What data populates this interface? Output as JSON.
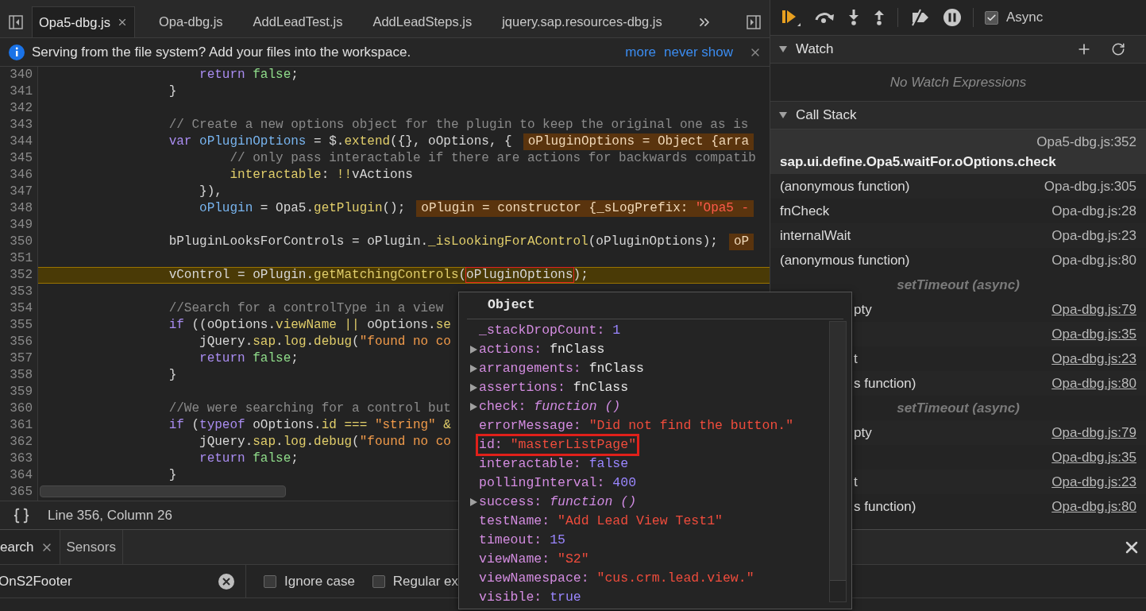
{
  "editor_tabs": [
    {
      "label": "Opa5-dbg.js",
      "selected": true,
      "closable": true
    },
    {
      "label": "Opa-dbg.js",
      "selected": false,
      "closable": false
    },
    {
      "label": "AddLeadTest.js",
      "selected": false,
      "closable": false
    },
    {
      "label": "AddLeadSteps.js",
      "selected": false,
      "closable": false
    },
    {
      "label": "jquery.sap.resources-dbg.js",
      "selected": false,
      "closable": false
    }
  ],
  "info_bar": {
    "message": "Serving from the file system? Add your files into the workspace.",
    "links": [
      "more",
      "never show"
    ]
  },
  "code": {
    "lines": [
      {
        "number": "340",
        "current": false,
        "tokens": [
          {
            "kind": "keyword",
            "text": "                    return "
          },
          {
            "kind": "literal",
            "text": "false"
          },
          {
            "kind": "plain",
            "text": ";"
          }
        ]
      },
      {
        "number": "341",
        "current": false,
        "tokens": [
          {
            "kind": "plain",
            "text": "                }"
          }
        ]
      },
      {
        "number": "342",
        "current": false
      },
      {
        "number": "343",
        "current": false,
        "tokens": [
          {
            "kind": "comment",
            "text": "                // Create a new options object for the plugin to keep the original one as is"
          }
        ]
      },
      {
        "number": "344",
        "current": false,
        "tokens": [
          {
            "kind": "keyword",
            "text": "                var "
          },
          {
            "kind": "def",
            "text": "oPluginOptions"
          },
          {
            "kind": "plain",
            "text": " = $."
          },
          {
            "kind": "prop",
            "text": "extend"
          },
          {
            "kind": "plain",
            "text": "({}, oOptions, {"
          }
        ],
        "inline_value": [
          {
            "kind": "plain",
            "text": "oPluginOptions = Object {arra"
          }
        ]
      },
      {
        "number": "345",
        "current": false,
        "tokens": [
          {
            "kind": "comment",
            "text": "                        // only pass interactable if there are actions for backwards compatib"
          }
        ]
      },
      {
        "number": "346",
        "current": false,
        "tokens": [
          {
            "kind": "prop",
            "text": "                        interactable"
          },
          {
            "kind": "plain",
            "text": ": "
          },
          {
            "kind": "prop",
            "text": "!!"
          },
          {
            "kind": "plain",
            "text": "vActions"
          }
        ]
      },
      {
        "number": "347",
        "current": false,
        "tokens": [
          {
            "kind": "plain",
            "text": "                    }),"
          }
        ]
      },
      {
        "number": "348",
        "current": false,
        "tokens": [
          {
            "kind": "def",
            "text": "                    oPlugin"
          },
          {
            "kind": "plain",
            "text": " = Opa5."
          },
          {
            "kind": "prop",
            "text": "getPlugin"
          },
          {
            "kind": "plain",
            "text": "();"
          }
        ],
        "inline_value": [
          {
            "kind": "plain",
            "text": "oPlugin = constructor {_sLogPrefix: "
          },
          {
            "kind": "string",
            "text": "\"Opa5 -"
          }
        ]
      },
      {
        "number": "349",
        "current": false
      },
      {
        "number": "350",
        "current": false,
        "tokens": [
          {
            "kind": "plain",
            "text": "                bPluginLooksForControls = oPlugin."
          },
          {
            "kind": "prop",
            "text": "_isLookingForAControl"
          },
          {
            "kind": "plain",
            "text": "(oPluginOptions);"
          }
        ],
        "inline_value": [
          {
            "kind": "plain",
            "text": "oP"
          }
        ]
      },
      {
        "number": "351",
        "current": false
      },
      {
        "number": "352",
        "current": true,
        "tokens": [
          {
            "kind": "plain",
            "text": "                vControl = oPlugin."
          },
          {
            "kind": "prop",
            "text": "getMatchingControls"
          },
          {
            "kind": "plain",
            "text": "("
          },
          {
            "kind": "hovered",
            "text": "oPluginOptions"
          },
          {
            "kind": "plain",
            "text": ");"
          }
        ]
      },
      {
        "number": "353",
        "current": false
      },
      {
        "number": "354",
        "current": false,
        "tokens": [
          {
            "kind": "comment",
            "text": "                //Search for a controlType in a view"
          }
        ]
      },
      {
        "number": "355",
        "current": false,
        "tokens": [
          {
            "kind": "keyword",
            "text": "                if"
          },
          {
            "kind": "plain",
            "text": " ((oOptions."
          },
          {
            "kind": "prop",
            "text": "viewName"
          },
          {
            "kind": "prop",
            "text": " || "
          },
          {
            "kind": "plain",
            "text": "oOptions."
          },
          {
            "kind": "prop",
            "text": "se"
          }
        ]
      },
      {
        "number": "356",
        "current": false,
        "tokens": [
          {
            "kind": "plain",
            "text": "                    jQuery."
          },
          {
            "kind": "prop",
            "text": "sap"
          },
          {
            "kind": "plain",
            "text": "."
          },
          {
            "kind": "prop",
            "text": "log"
          },
          {
            "kind": "plain",
            "text": "."
          },
          {
            "kind": "prop",
            "text": "debug"
          },
          {
            "kind": "plain",
            "text": "("
          },
          {
            "kind": "string",
            "text": "\"found no co"
          }
        ]
      },
      {
        "number": "357",
        "current": false,
        "tokens": [
          {
            "kind": "keyword",
            "text": "                    return "
          },
          {
            "kind": "literal",
            "text": "false"
          },
          {
            "kind": "plain",
            "text": ";"
          }
        ]
      },
      {
        "number": "358",
        "current": false,
        "tokens": [
          {
            "kind": "plain",
            "text": "                }"
          }
        ]
      },
      {
        "number": "359",
        "current": false
      },
      {
        "number": "360",
        "current": false,
        "tokens": [
          {
            "kind": "comment",
            "text": "                //We were searching for a control but"
          }
        ]
      },
      {
        "number": "361",
        "current": false,
        "tokens": [
          {
            "kind": "keyword",
            "text": "                if"
          },
          {
            "kind": "plain",
            "text": " ("
          },
          {
            "kind": "keyword",
            "text": "typeof"
          },
          {
            "kind": "plain",
            "text": " oOptions."
          },
          {
            "kind": "prop",
            "text": "id"
          },
          {
            "kind": "prop",
            "text": " === "
          },
          {
            "kind": "string",
            "text": "\"string\""
          },
          {
            "kind": "prop",
            "text": " &"
          }
        ]
      },
      {
        "number": "362",
        "current": false,
        "tokens": [
          {
            "kind": "plain",
            "text": "                    jQuery."
          },
          {
            "kind": "prop",
            "text": "sap"
          },
          {
            "kind": "plain",
            "text": "."
          },
          {
            "kind": "prop",
            "text": "log"
          },
          {
            "kind": "plain",
            "text": "."
          },
          {
            "kind": "prop",
            "text": "debug"
          },
          {
            "kind": "plain",
            "text": "("
          },
          {
            "kind": "string",
            "text": "\"found no co"
          }
        ]
      },
      {
        "number": "363",
        "current": false,
        "tokens": [
          {
            "kind": "keyword",
            "text": "                    return "
          },
          {
            "kind": "literal",
            "text": "false"
          },
          {
            "kind": "plain",
            "text": ";"
          }
        ]
      },
      {
        "number": "364",
        "current": false,
        "tokens": [
          {
            "kind": "plain",
            "text": "                }"
          }
        ]
      },
      {
        "number": "365",
        "current": false
      }
    ]
  },
  "status_bar": {
    "position": "Line 356, Column 26"
  },
  "debugger": {
    "async": {
      "label": "Async",
      "checked": true
    },
    "watch": {
      "title": "Watch",
      "expanded": true,
      "empty_text": "No Watch Expressions"
    },
    "call_stack": {
      "title": "Call Stack",
      "expanded": true,
      "frames": [
        {
          "kind": "frame",
          "name": "sap.ui.define.Opa5.waitFor.oOptions.check",
          "location": "Opa5-dbg.js:352",
          "selected": true,
          "linked": false,
          "covered": false
        },
        {
          "kind": "frame",
          "name": "(anonymous function)",
          "location": "Opa-dbg.js:305",
          "selected": false,
          "linked": false,
          "covered": false
        },
        {
          "kind": "frame",
          "name": "fnCheck",
          "location": "Opa-dbg.js:28",
          "selected": false,
          "linked": false,
          "covered": false
        },
        {
          "kind": "frame",
          "name": "internalWait",
          "location": "Opa-dbg.js:23",
          "selected": false,
          "linked": false,
          "covered": false
        },
        {
          "kind": "frame",
          "name": "(anonymous function)",
          "location": "Opa-dbg.js:80",
          "selected": false,
          "linked": false,
          "covered": false
        },
        {
          "kind": "async",
          "name": "setTimeout (async)",
          "selected": false
        },
        {
          "kind": "frame",
          "name": "pty",
          "location": "Opa-dbg.js:79",
          "selected": false,
          "linked": true,
          "covered": true
        },
        {
          "kind": "frame",
          "location": "Opa-dbg.js:35",
          "selected": false,
          "linked": true,
          "covered": true
        },
        {
          "kind": "frame",
          "name": "t",
          "location": "Opa-dbg.js:23",
          "selected": false,
          "linked": true,
          "covered": true
        },
        {
          "kind": "frame",
          "name": "s function)",
          "location": "Opa-dbg.js:80",
          "selected": false,
          "linked": true,
          "covered": true
        },
        {
          "kind": "async",
          "name": "setTimeout (async)",
          "selected": false
        },
        {
          "kind": "frame",
          "name": "pty",
          "location": "Opa-dbg.js:79",
          "selected": false,
          "linked": true,
          "covered": true
        },
        {
          "kind": "frame",
          "location": "Opa-dbg.js:35",
          "selected": false,
          "linked": true,
          "covered": true
        },
        {
          "kind": "frame",
          "name": "t",
          "location": "Opa-dbg.js:23",
          "selected": false,
          "linked": true,
          "covered": true
        },
        {
          "kind": "frame",
          "name": "s function)",
          "location": "Opa-dbg.js:80",
          "selected": false,
          "linked": true,
          "covered": true
        }
      ]
    }
  },
  "drawer": {
    "tabs": [
      {
        "label": "earch",
        "selected": true,
        "closable": true
      },
      {
        "label": "Sensors",
        "selected": false,
        "closable": false
      }
    ],
    "search": {
      "value": "OnS2Footer"
    },
    "options": [
      {
        "label": "Ignore case",
        "checked": false
      },
      {
        "label": "Regular ex",
        "checked": false
      }
    ]
  },
  "popup": {
    "title": "Object",
    "properties": [
      {
        "name": "_stackDropCount:",
        "value": "1",
        "kind": "number",
        "expandable": false,
        "highlighted": false
      },
      {
        "name": "actions:",
        "value": "fnClass",
        "kind": "object",
        "expandable": true,
        "highlighted": false
      },
      {
        "name": "arrangements:",
        "value": "fnClass",
        "kind": "object",
        "expandable": true,
        "highlighted": false
      },
      {
        "name": "assertions:",
        "value": "fnClass",
        "kind": "object",
        "expandable": true,
        "highlighted": false
      },
      {
        "name": "check:",
        "value": "function ()",
        "kind": "function",
        "expandable": true,
        "highlighted": false
      },
      {
        "name": "errorMessage:",
        "value": "\"Did not find the button.\"",
        "kind": "string",
        "expandable": false,
        "highlighted": false
      },
      {
        "name": "id:",
        "value": "\"masterListPage\"",
        "kind": "string",
        "expandable": false,
        "highlighted": true
      },
      {
        "name": "interactable:",
        "value": "false",
        "kind": "boolean",
        "expandable": false,
        "highlighted": false
      },
      {
        "name": "pollingInterval:",
        "value": "400",
        "kind": "number",
        "expandable": false,
        "highlighted": false
      },
      {
        "name": "success:",
        "value": "function ()",
        "kind": "function",
        "expandable": true,
        "highlighted": false
      },
      {
        "name": "testName:",
        "value": "\"Add Lead View Test1\"",
        "kind": "string",
        "expandable": false,
        "highlighted": false
      },
      {
        "name": "timeout:",
        "value": "15",
        "kind": "number",
        "expandable": false,
        "highlighted": false
      },
      {
        "name": "viewName:",
        "value": "\"S2\"",
        "kind": "string",
        "expandable": false,
        "highlighted": false
      },
      {
        "name": "viewNamespace:",
        "value": "\"cus.crm.lead.view.\"",
        "kind": "string",
        "expandable": false,
        "highlighted": false
      },
      {
        "name": "visible:",
        "value": "true",
        "kind": "boolean",
        "expandable": false,
        "highlighted": false
      }
    ]
  }
}
